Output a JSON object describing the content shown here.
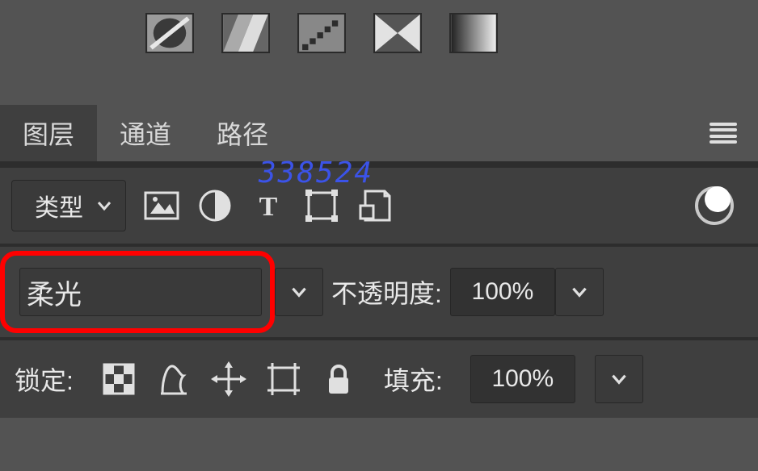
{
  "tabs": {
    "layers": "图层",
    "channels": "通道",
    "paths": "路径"
  },
  "filter": {
    "kind_label": "类型"
  },
  "blend": {
    "mode": "柔光",
    "opacity_label": "不透明度:",
    "opacity_value": "100%"
  },
  "lock": {
    "label": "锁定:",
    "fill_label": "填充:",
    "fill_value": "100%"
  },
  "watermark": "338524"
}
